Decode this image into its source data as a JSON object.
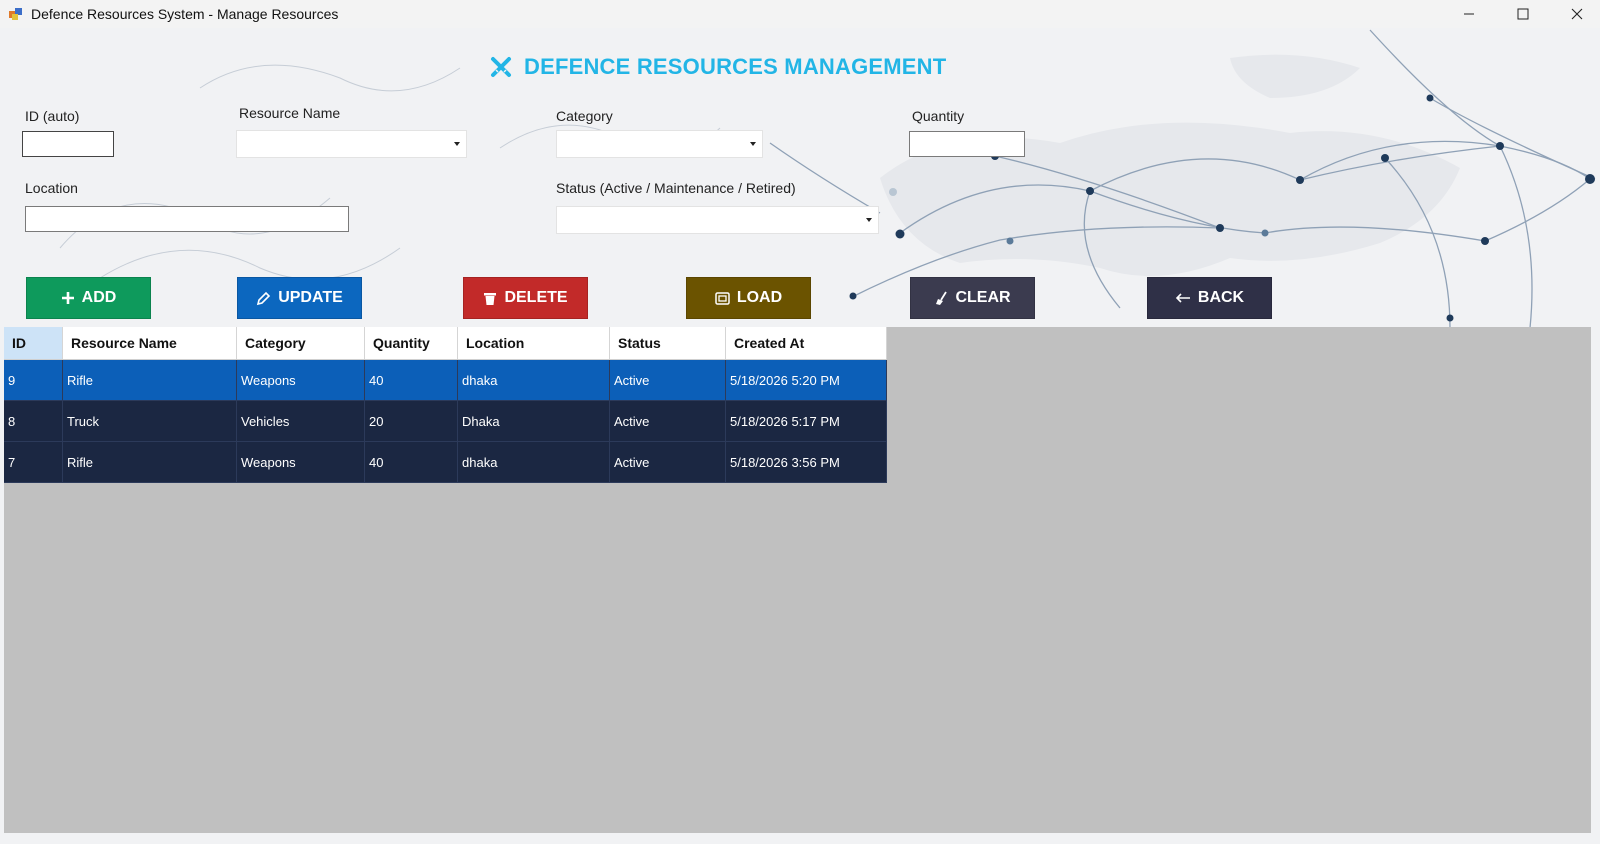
{
  "window": {
    "title": "Defence Resources System - Manage Resources",
    "controls": [
      "minimize",
      "maximize",
      "close"
    ]
  },
  "header": {
    "title": "DEFENCE RESOURCES MANAGEMENT",
    "icon": "crossed-swords-icon",
    "color": "#22b5e6"
  },
  "form": {
    "id_label": "ID (auto)",
    "id_value": "",
    "resource_name_label": "Resource Name",
    "resource_name_value": "",
    "category_label": "Category",
    "category_value": "",
    "quantity_label": "Quantity",
    "quantity_value": "",
    "location_label": "Location",
    "location_value": "",
    "status_label": "Status (Active / Maintenance / Retired)",
    "status_value": ""
  },
  "buttons": {
    "add": {
      "label": "ADD",
      "icon": "plus-icon",
      "color": "#0e9a5c"
    },
    "update": {
      "label": "UPDATE",
      "icon": "pencil-icon",
      "color": "#0c67bf"
    },
    "delete": {
      "label": "DELETE",
      "icon": "trash-icon",
      "color": "#c22a29"
    },
    "load": {
      "label": "LOAD",
      "icon": "load-icon",
      "color": "#6b5300"
    },
    "clear": {
      "label": "CLEAR",
      "icon": "broom-icon",
      "color": "#3b3b4f"
    },
    "back": {
      "label": "BACK",
      "icon": "arrow-left-icon",
      "color": "#2f3047"
    }
  },
  "grid": {
    "columns": [
      "ID",
      "Resource Name",
      "Category",
      "Quantity",
      "Location",
      "Status",
      "Created At"
    ],
    "rows": [
      [
        "9",
        "Rifle",
        "Weapons",
        "40",
        "dhaka",
        "Active",
        "5/18/2026 5:20 PM"
      ],
      [
        "8",
        "Truck",
        "Vehicles",
        "20",
        "Dhaka",
        "Active",
        "5/18/2026 5:17 PM"
      ],
      [
        "7",
        "Rifle",
        "Weapons",
        "40",
        "dhaka",
        "Active",
        "5/18/2026 3:56 PM"
      ]
    ],
    "selected_row": 0,
    "row_color": "#1b2742",
    "selected_color": "#0c5fb8"
  }
}
